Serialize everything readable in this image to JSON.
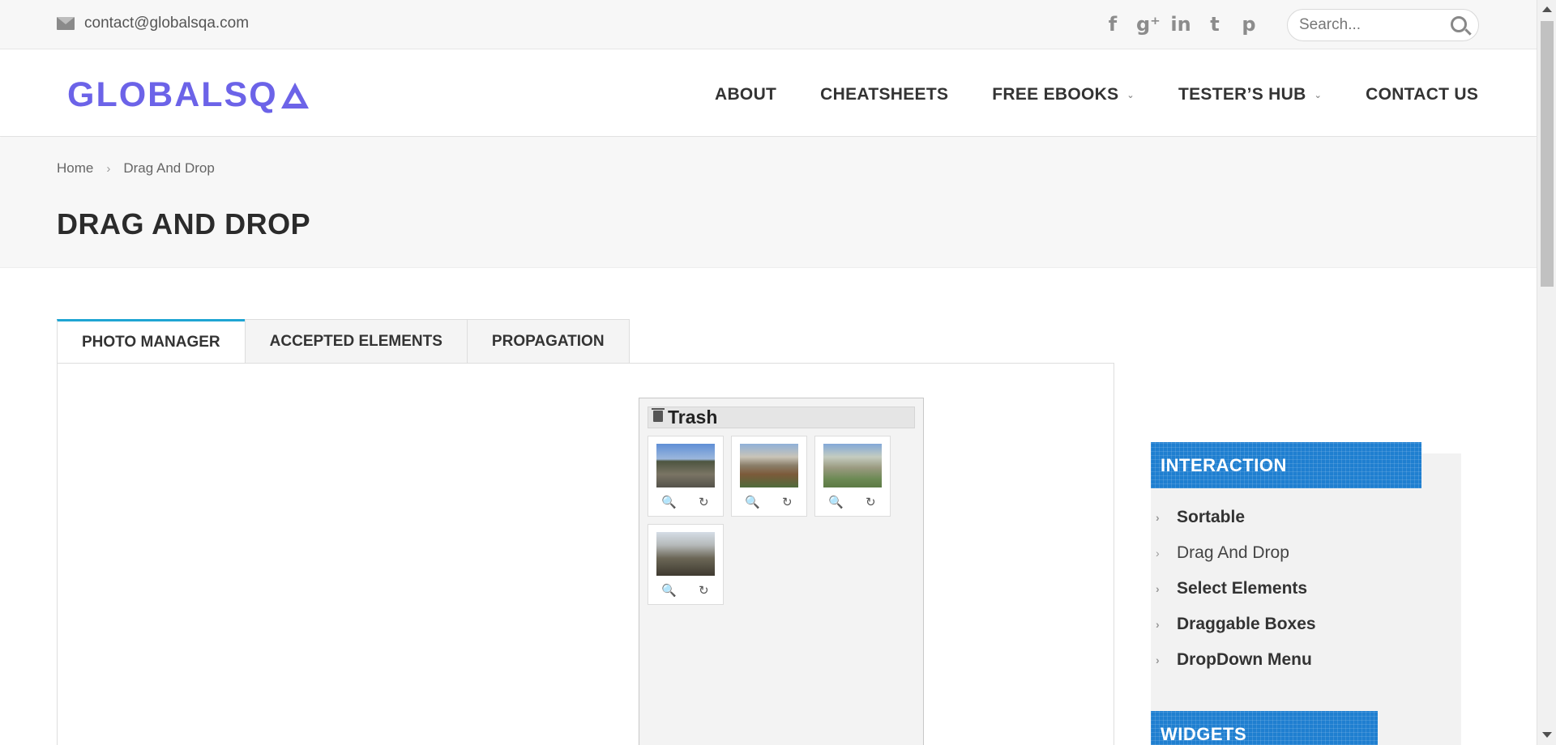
{
  "topbar": {
    "email": "contact@globalsqa.com",
    "social_icons": [
      "facebook-icon",
      "google-plus-icon",
      "linkedin-icon",
      "twitter-icon",
      "pinterest-icon"
    ],
    "search_placeholder": "Search..."
  },
  "header": {
    "logo_text": "GLOBALSQ",
    "nav": [
      {
        "label": "ABOUT",
        "has_dropdown": false
      },
      {
        "label": "CHEATSHEETS",
        "has_dropdown": false
      },
      {
        "label": "FREE EBOOKS",
        "has_dropdown": true
      },
      {
        "label": "TESTER’S HUB",
        "has_dropdown": true
      },
      {
        "label": "CONTACT US",
        "has_dropdown": false
      }
    ]
  },
  "breadcrumb": {
    "home": "Home",
    "separator": "›",
    "current": "Drag And Drop"
  },
  "page_title": "DRAG AND DROP",
  "tabs": [
    {
      "label": "PHOTO MANAGER",
      "active": true
    },
    {
      "label": "ACCEPTED ELEMENTS",
      "active": false
    },
    {
      "label": "PROPAGATION",
      "active": false
    }
  ],
  "trash": {
    "title": "Trash",
    "photos": [
      {
        "name": "photo-1"
      },
      {
        "name": "photo-2"
      },
      {
        "name": "photo-3"
      },
      {
        "name": "photo-4"
      }
    ]
  },
  "sidebar": {
    "interaction_title": "INTERACTION",
    "items": [
      "Sortable",
      "Drag And Drop",
      "Select Elements",
      "Draggable Boxes",
      "DropDown Menu"
    ],
    "widgets_title": "WIDGETS"
  },
  "colors": {
    "logo": "#6c63e8",
    "tab_accent": "#1fa5d3",
    "widget_header": "#1f7fd0"
  }
}
